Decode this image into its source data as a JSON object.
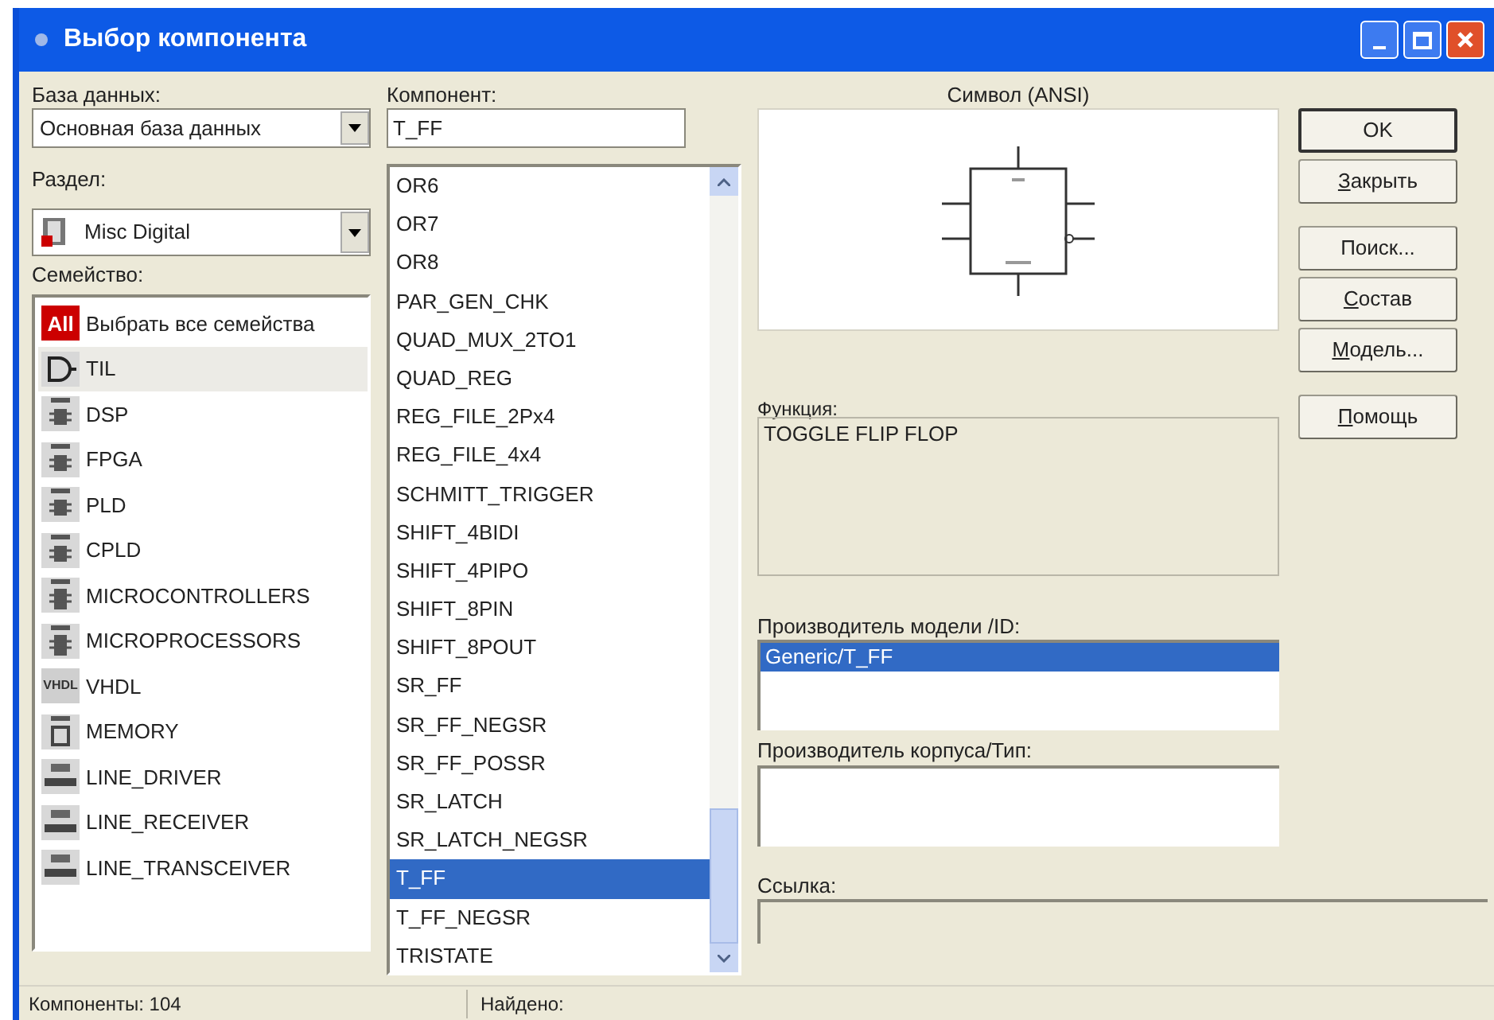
{
  "window": {
    "title": "Выбор компонента"
  },
  "database": {
    "label": "База данных:",
    "value": "Основная база данных"
  },
  "section": {
    "label": "Раздел:",
    "value": "Misc Digital"
  },
  "families": {
    "label": "Семейство:",
    "items": [
      {
        "kind": "all",
        "icon_label": "All",
        "label": "Выбрать все семейства",
        "selected": false
      },
      {
        "kind": "gate",
        "label": "TIL",
        "selected": true
      },
      {
        "kind": "chip",
        "label": "DSP",
        "selected": false
      },
      {
        "kind": "chip",
        "label": "FPGA",
        "selected": false
      },
      {
        "kind": "chip",
        "label": "PLD",
        "selected": false
      },
      {
        "kind": "chip",
        "label": "CPLD",
        "selected": false
      },
      {
        "kind": "tallchip",
        "label": "MICROCONTROLLERS",
        "selected": false
      },
      {
        "kind": "tallchip",
        "label": "MICROPROCESSORS",
        "selected": false
      },
      {
        "kind": "vhdl",
        "icon_label": "VHDL",
        "label": "VHDL",
        "selected": false
      },
      {
        "kind": "memory",
        "label": "MEMORY",
        "selected": false
      },
      {
        "kind": "line",
        "label": "LINE_DRIVER",
        "selected": false
      },
      {
        "kind": "line",
        "label": "LINE_RECEIVER",
        "selected": false
      },
      {
        "kind": "line",
        "label": "LINE_TRANSCEIVER",
        "selected": false
      }
    ]
  },
  "component": {
    "label": "Компонент:",
    "value": "T_FF",
    "items": [
      {
        "label": "OR6",
        "selected": false
      },
      {
        "label": "OR7",
        "selected": false
      },
      {
        "label": "OR8",
        "selected": false
      },
      {
        "label": "PAR_GEN_CHK",
        "selected": false
      },
      {
        "label": "QUAD_MUX_2TO1",
        "selected": false
      },
      {
        "label": "QUAD_REG",
        "selected": false
      },
      {
        "label": "REG_FILE_2Px4",
        "selected": false
      },
      {
        "label": "REG_FILE_4x4",
        "selected": false
      },
      {
        "label": "SCHMITT_TRIGGER",
        "selected": false
      },
      {
        "label": "SHIFT_4BIDI",
        "selected": false
      },
      {
        "label": "SHIFT_4PIPO",
        "selected": false
      },
      {
        "label": "SHIFT_8PIN",
        "selected": false
      },
      {
        "label": "SHIFT_8POUT",
        "selected": false
      },
      {
        "label": "SR_FF",
        "selected": false
      },
      {
        "label": "SR_FF_NEGSR",
        "selected": false
      },
      {
        "label": "SR_FF_POSSR",
        "selected": false
      },
      {
        "label": "SR_LATCH",
        "selected": false
      },
      {
        "label": "SR_LATCH_NEGSR",
        "selected": false
      },
      {
        "label": "T_FF",
        "selected": true
      },
      {
        "label": "T_FF_NEGSR",
        "selected": false
      },
      {
        "label": "TRISTATE",
        "selected": false
      }
    ]
  },
  "symbol": {
    "label": "Символ (ANSI)"
  },
  "function": {
    "label": "Функция:",
    "value": "TOGGLE FLIP FLOP"
  },
  "model_vendor": {
    "label": "Производитель модели /ID:",
    "items": [
      {
        "label": "Generic/T_FF",
        "selected": true
      }
    ]
  },
  "package_vendor": {
    "label": "Производитель корпуса/Тип:"
  },
  "link": {
    "label": "Ссылка:"
  },
  "buttons": [
    {
      "label": "OK",
      "default": true,
      "underline_first": false
    },
    {
      "label": "Закрыть",
      "default": false,
      "underline_first": true
    },
    {
      "label": "Поиск...",
      "default": false,
      "underline_first": false
    },
    {
      "label": "Состав",
      "default": false,
      "underline_first": true
    },
    {
      "label": "Модель...",
      "default": false,
      "underline_first": true
    },
    {
      "label": "Помощь",
      "default": false,
      "underline_first": true
    }
  ],
  "status_bar": {
    "components": "Компоненты: 104",
    "found": "Найдено:"
  }
}
